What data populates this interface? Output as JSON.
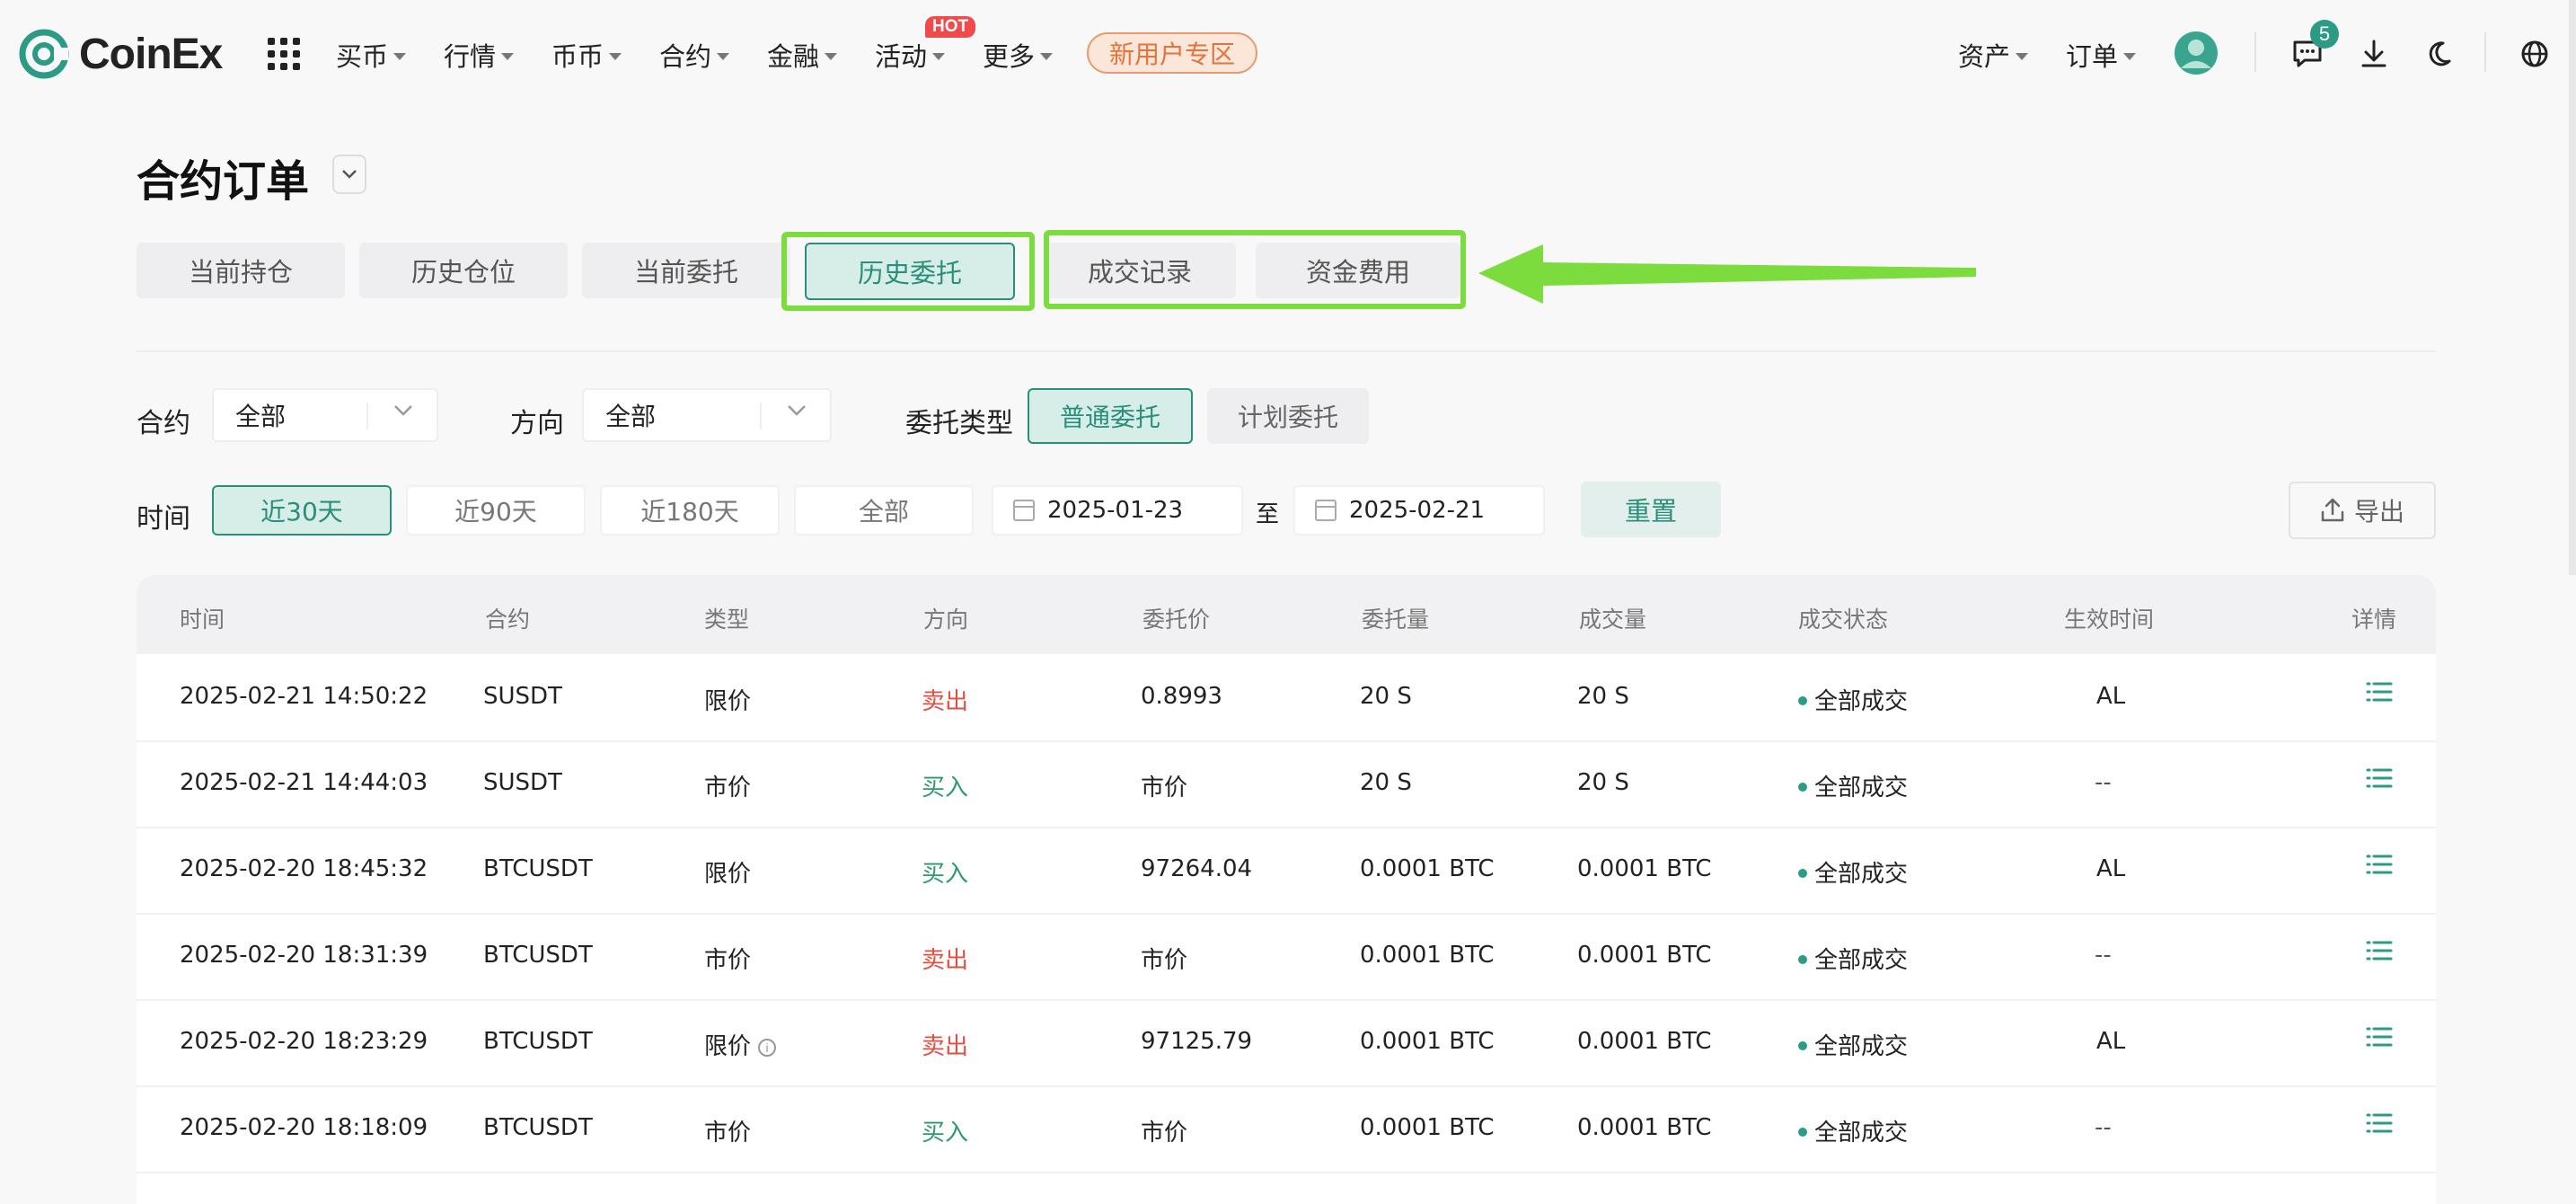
{
  "nav": {
    "logo": "CoinEx",
    "items": [
      {
        "label": "买币"
      },
      {
        "label": "行情"
      },
      {
        "label": "币币"
      },
      {
        "label": "合约"
      },
      {
        "label": "金融"
      },
      {
        "label": "活动"
      },
      {
        "label": "更多"
      }
    ],
    "hot_badge": "HOT",
    "promo": "新用户专区",
    "right": {
      "assets": "资产",
      "orders": "订单",
      "message_count": "5"
    }
  },
  "page": {
    "title": "合约订单",
    "tabs": [
      {
        "label": "当前持仓",
        "active": false
      },
      {
        "label": "历史仓位",
        "active": false
      },
      {
        "label": "当前委托",
        "active": false
      },
      {
        "label": "历史委托",
        "active": true
      },
      {
        "label": "成交记录",
        "active": false
      },
      {
        "label": "资金费用",
        "active": false
      }
    ]
  },
  "filters": {
    "contract_label": "合约",
    "contract_value": "全部",
    "direction_label": "方向",
    "direction_value": "全部",
    "order_type_label": "委托类型",
    "order_types": [
      "普通委托",
      "计划委托"
    ],
    "time_label": "时间",
    "time_ranges": [
      "近30天",
      "近90天",
      "近180天",
      "全部"
    ],
    "date_start": "2025-01-23",
    "date_sep": "至",
    "date_end": "2025-02-21",
    "reset": "重置",
    "export": "导出"
  },
  "table": {
    "headers": [
      "时间",
      "合约",
      "类型",
      "方向",
      "委托价",
      "委托量",
      "成交量",
      "成交状态",
      "生效时间",
      "详情"
    ],
    "rows": [
      {
        "time": "2025-02-21 14:50:22",
        "contract": "SUSDT",
        "type": "限价",
        "side": "卖出",
        "price": "0.8993",
        "qty": "20 S",
        "filled": "20 S",
        "status": "全部成交",
        "effective": "AL"
      },
      {
        "time": "2025-02-21 14:44:03",
        "contract": "SUSDT",
        "type": "市价",
        "side": "买入",
        "price": "市价",
        "qty": "20 S",
        "filled": "20 S",
        "status": "全部成交",
        "effective": "--"
      },
      {
        "time": "2025-02-20 18:45:32",
        "contract": "BTCUSDT",
        "type": "限价",
        "side": "买入",
        "price": "97264.04",
        "qty": "0.0001 BTC",
        "filled": "0.0001 BTC",
        "status": "全部成交",
        "effective": "AL"
      },
      {
        "time": "2025-02-20 18:31:39",
        "contract": "BTCUSDT",
        "type": "市价",
        "side": "卖出",
        "price": "市价",
        "qty": "0.0001 BTC",
        "filled": "0.0001 BTC",
        "status": "全部成交",
        "effective": "--"
      },
      {
        "time": "2025-02-20 18:23:29",
        "contract": "BTCUSDT",
        "type": "限价",
        "side": "卖出",
        "price": "97125.79",
        "qty": "0.0001 BTC",
        "filled": "0.0001 BTC",
        "status": "全部成交",
        "effective": "AL"
      },
      {
        "time": "2025-02-20 18:18:09",
        "contract": "BTCUSDT",
        "type": "市价",
        "side": "买入",
        "price": "市价",
        "qty": "0.0001 BTC",
        "filled": "0.0001 BTC",
        "status": "全部成交",
        "effective": "--"
      }
    ]
  },
  "colors": {
    "accent": "#2a8f7a",
    "sell": "#e54d42",
    "buy": "#2a9b6e",
    "highlight": "#7ddc3d"
  }
}
